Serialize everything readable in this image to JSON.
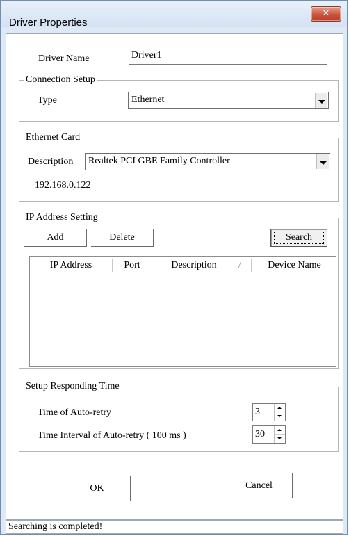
{
  "window": {
    "title": "Driver Properties",
    "close_icon": "close-icon"
  },
  "driver_name": {
    "label": "Driver Name",
    "value": "Driver1"
  },
  "connection_setup": {
    "title": "Connection Setup",
    "type_label": "Type",
    "type_value": "Ethernet"
  },
  "ethernet_card": {
    "title": "Ethernet Card",
    "description_label": "Description",
    "description_value": "Realtek PCI GBE Family Controller",
    "ip": "192.168.0.122"
  },
  "ip_address_setting": {
    "title": "IP Address Setting",
    "add_label": "Add",
    "delete_label": "Delete",
    "search_label": "Search",
    "columns": [
      "IP Address",
      "Port",
      "Description",
      "/",
      "Device Name"
    ]
  },
  "responding_time": {
    "title": "Setup Responding Time",
    "auto_retry_label": "Time of Auto-retry",
    "auto_retry_value": "3",
    "interval_label": "Time Interval of Auto-retry ( 100 ms )",
    "interval_value": "30"
  },
  "buttons": {
    "ok": "OK",
    "cancel": "Cancel"
  },
  "status": "Searching is completed!"
}
